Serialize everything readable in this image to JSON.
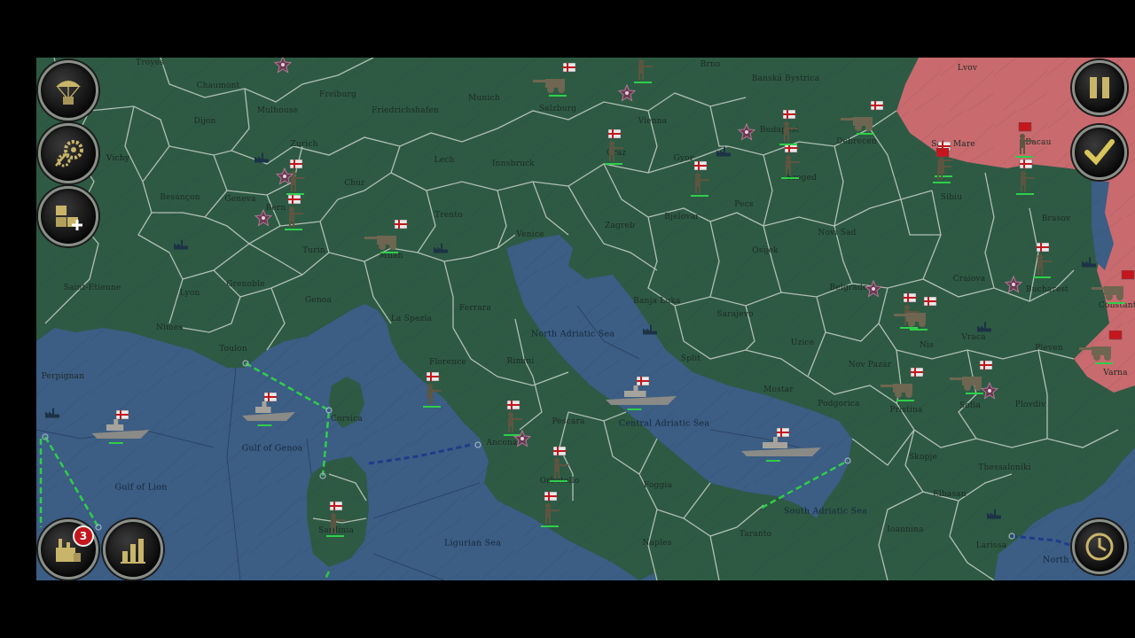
{
  "colors": {
    "land": "#2e5a44",
    "sea": "#3c5d84",
    "enemy": "#c86a6e",
    "border": "#c9d2c6",
    "route": "#2fcf4a",
    "flag": "#e8e8e8",
    "flag_cross": "#c4161c",
    "badge": "#c4161c",
    "hud_gold": "#c9b56a"
  },
  "hud": {
    "paratroop": {
      "icon": "parachute-icon"
    },
    "research": {
      "icon": "gears-icon"
    },
    "supply": {
      "icon": "crates-plus-icon"
    },
    "pause": {
      "icon": "pause-icon"
    },
    "end_turn": {
      "icon": "checkmark-icon"
    },
    "production": {
      "icon": "factory-icon",
      "badge": "3"
    },
    "stats": {
      "icon": "bar-chart-icon"
    },
    "turn_clock": {
      "icon": "clock-icon"
    }
  },
  "cities": [
    "Troyes",
    "Chaumont",
    "Freiburg",
    "Munich",
    "Salzburg",
    "Vienna",
    "Brno",
    "Banská Bystrica",
    "Lvov",
    "Dijon",
    "Mulhouse",
    "Friedrichshafen",
    "Graz",
    "Budapest",
    "Debrecen",
    "Satu Mare",
    "Bacau",
    "Vichy",
    "Zurich",
    "Lech",
    "Innsbruck",
    "Gyor",
    "Besançon",
    "Chur",
    "Geneva",
    "Bern",
    "Trento",
    "Szeged",
    "Sibiu",
    "Venice",
    "Zagreb",
    "Bjelovar",
    "Pecs",
    "Novi Sad",
    "Brasov",
    "Turin",
    "Milan",
    "Osijek",
    "Craiova",
    "Grenoble",
    "Lyon",
    "Saint-Etienne",
    "Perpignan",
    "Genoa",
    "La Spezia",
    "Ferrara",
    "Banja Luka",
    "Sarajevo",
    "Belgrade",
    "Bucharest",
    "Constanta",
    "Nimes",
    "Toulon",
    "Florence",
    "Rimini",
    "Split",
    "Uzice",
    "Vraca",
    "Pleven",
    "Nis",
    "Nov Pazar",
    "Mostar",
    "Varna",
    "Podgorica",
    "Pristina",
    "Sofia",
    "Plovdiv",
    "Ancona",
    "Pescara",
    "Skopje",
    "Thessaloniki",
    "Foggia",
    "Elbasan",
    "Taranto",
    "Ioannina",
    "Larissa",
    "Naples",
    "Sardinia",
    "Corsica",
    "Orbetello",
    "Vichy"
  ],
  "seas": [
    "North Adriatic Sea",
    "Central Adriatic Sea",
    "South Adriatic Sea",
    "Gulf of Genoa",
    "Gulf of Lion",
    "Ligurian Sea",
    "North Aegean"
  ]
}
